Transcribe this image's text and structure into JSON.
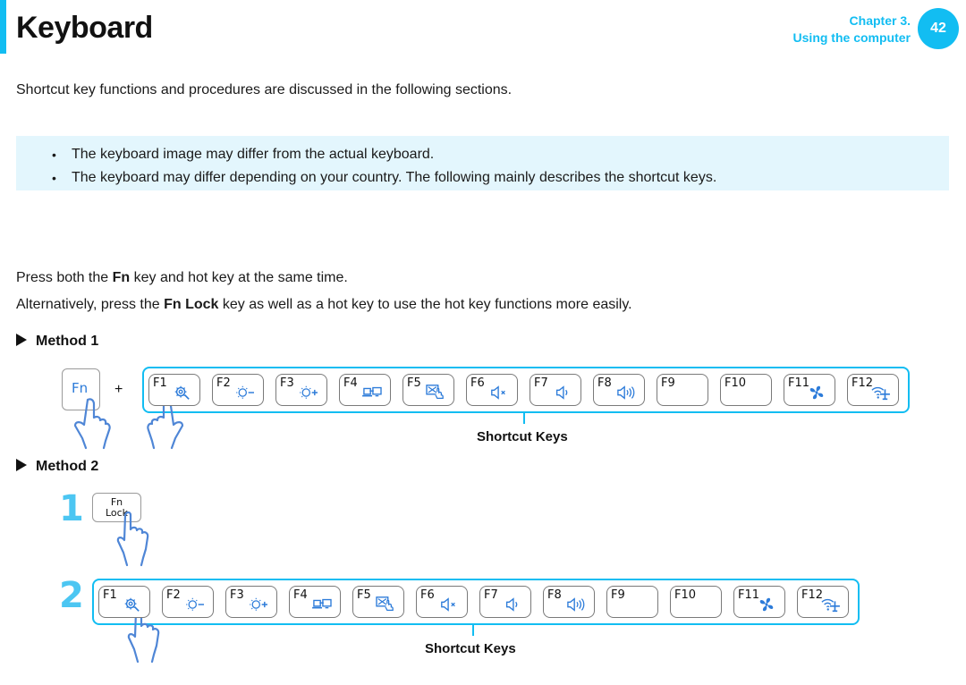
{
  "header": {
    "title": "Keyboard",
    "chapter_line1": "Chapter 3.",
    "chapter_line2": "Using the computer",
    "page_number": "42",
    "accent_color": "#12bdf2"
  },
  "intro": "Shortcut key functions and procedures are discussed in the following sections.",
  "notes": [
    "The keyboard image may differ from the actual keyboard.",
    "The keyboard may differ depending on your country. The following mainly describes the shortcut keys."
  ],
  "instructions": {
    "line1_pre": "Press both the ",
    "line1_bold": "Fn",
    "line1_post": " key and hot key at the same time.",
    "line2_pre": "Alternatively, press the ",
    "line2_bold": "Fn Lock",
    "line2_post": " key as well as a hot key to use the hot key functions more easily."
  },
  "method1": {
    "heading": "Method 1",
    "fn_key_label": "Fn",
    "plus": "+",
    "shortcut_label": "Shortcut Keys"
  },
  "method2": {
    "heading": "Method 2",
    "step1": "1",
    "step2": "2",
    "fn_lock_line1": "Fn",
    "fn_lock_line2": "Lock",
    "shortcut_label": "Shortcut Keys"
  },
  "function_keys": [
    {
      "label": "F1",
      "icon": "settings-icon"
    },
    {
      "label": "F2",
      "icon": "brightness-down-icon"
    },
    {
      "label": "F3",
      "icon": "brightness-up-icon"
    },
    {
      "label": "F4",
      "icon": "display-switch-icon"
    },
    {
      "label": "F5",
      "icon": "touchpad-toggle-icon"
    },
    {
      "label": "F6",
      "icon": "mute-icon"
    },
    {
      "label": "F7",
      "icon": "volume-down-icon"
    },
    {
      "label": "F8",
      "icon": "volume-up-icon"
    },
    {
      "label": "F9",
      "icon": ""
    },
    {
      "label": "F10",
      "icon": ""
    },
    {
      "label": "F11",
      "icon": "fan-icon"
    },
    {
      "label": "F12",
      "icon": "airplane-mode-icon"
    }
  ]
}
